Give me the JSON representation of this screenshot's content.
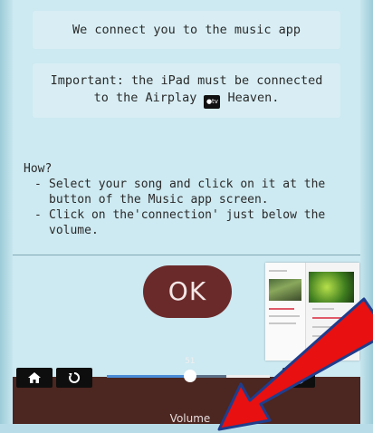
{
  "info": {
    "connect_text": "We connect you to the music app",
    "important_line1": "Important: the iPad must be connected",
    "important_line2_before": "to the Airplay",
    "important_line2_after": "Heaven.",
    "tv_badge": "●tv"
  },
  "how": {
    "header": "How?",
    "steps": [
      "Select your song and click on it at the button of the Music app screen.",
      "Click on the'connection' just below the volume."
    ]
  },
  "ok_button": {
    "label": "OK"
  },
  "controls": {
    "home_icon": "home-icon",
    "repeat_icon": "repeat-icon",
    "airplay_icon": "airplay-icon",
    "volume_value": "51",
    "volume_label": "Volume",
    "volume_fraction": 0.51
  },
  "colors": {
    "background": "#cde9f1",
    "ok_button": "#6b2a2a",
    "bottom_bar": "#4c2620",
    "arrow_fill": "#e81010",
    "arrow_outline": "#1f3d8c"
  }
}
